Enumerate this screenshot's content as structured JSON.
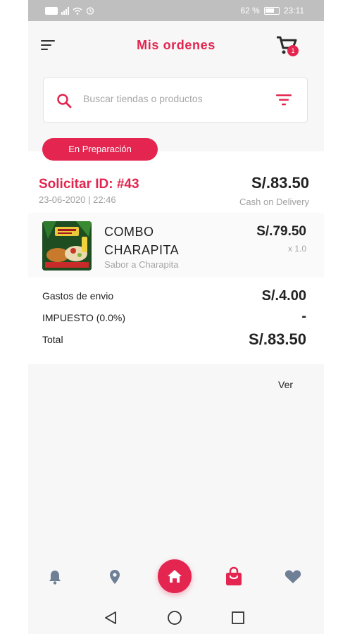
{
  "status_bar": {
    "battery": "62 %",
    "time": "23:11"
  },
  "header": {
    "title": "Mis ordenes",
    "cart_count": "1"
  },
  "search": {
    "placeholder": "Buscar tiendas o productos"
  },
  "order": {
    "status": "En Preparación",
    "id_label": "Solicitar ID: #43",
    "datetime": "23-06-2020 | 22:46",
    "total": "S/.83.50",
    "payment_method": "Cash on Delivery",
    "items": [
      {
        "name": "COMBO CHARAPITA",
        "subtitle": "Sabor a Charapita",
        "price": "S/.79.50",
        "quantity": "x 1.0"
      }
    ],
    "summary": {
      "shipping_label": "Gastos de envio",
      "shipping_value": "S/.4.00",
      "tax_label": "IMPUESTO (0.0%)",
      "tax_value": "-",
      "total_label": "Total",
      "total_value": "S/.83.50"
    },
    "view_link": "Ver"
  },
  "bottom_nav": {
    "items": [
      "bell-icon",
      "location-pin-icon",
      "home-icon",
      "shopping-bag-icon",
      "heart-icon"
    ],
    "active": "home-icon"
  },
  "colors": {
    "accent": "#e3254f",
    "inactive_icon": "#6e7f96"
  }
}
